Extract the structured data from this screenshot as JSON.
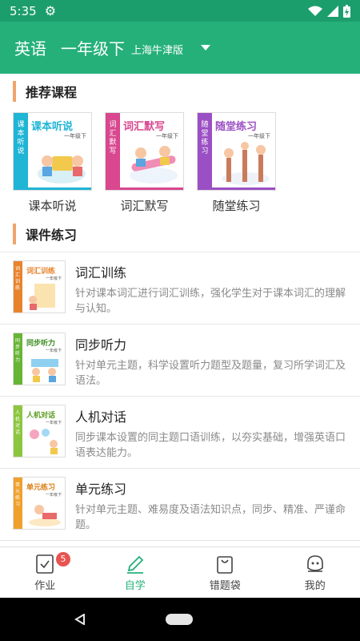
{
  "status": {
    "time": "5:35"
  },
  "header": {
    "subject": "英语",
    "grade": "一年级下",
    "edition": "上海牛津版"
  },
  "recommended": {
    "title": "推荐课程",
    "cards": [
      {
        "label": "课本听说",
        "cover_title": "课本听说",
        "spine": "课本听说",
        "grade": "一年级下",
        "color": "#1fb5d4"
      },
      {
        "label": "词汇默写",
        "cover_title": "词汇默写",
        "spine": "词汇默写",
        "grade": "一年级下",
        "color": "#d9478f"
      },
      {
        "label": "随堂练习",
        "cover_title": "随堂练习",
        "spine": "随堂练习",
        "grade": "一年级下",
        "color": "#9b4fc4"
      }
    ]
  },
  "practice": {
    "title": "课件练习",
    "items": [
      {
        "name": "词汇训练",
        "desc": "针对课本词汇进行词汇训练，强化学生对于课本词汇的理解与认知。",
        "thumb_title": "词汇训练",
        "spine": "词汇训练",
        "grade": "一年级下",
        "color": "#e8832d"
      },
      {
        "name": "同步听力",
        "desc": "针对单元主题，科学设置听力题型及题量，复习所学词汇及语法。",
        "thumb_title": "同步听力",
        "spine": "同步听力",
        "grade": "一年级下",
        "color": "#66b534"
      },
      {
        "name": "人机对话",
        "desc": "同步课本设置的同主题口语训练，以夯实基础，增强英语口语表达能力。",
        "thumb_title": "人机对话",
        "spine": "人机对话",
        "grade": "一年级下",
        "color": "#8cc63e"
      },
      {
        "name": "单元练习",
        "desc": "针对单元主题、难易度及语法知识点，同步、精准、严谨命题。",
        "thumb_title": "单元练习",
        "spine": "单元练习",
        "grade": "一年级下",
        "color": "#f0a02c"
      }
    ]
  },
  "tabs": [
    {
      "label": "作业",
      "icon": "homework-icon",
      "badge": "5"
    },
    {
      "label": "自学",
      "icon": "pencil-icon",
      "active": true
    },
    {
      "label": "错题袋",
      "icon": "bag-icon"
    },
    {
      "label": "我的",
      "icon": "profile-icon"
    }
  ],
  "colors": {
    "primary": "#25b07a",
    "status_bar": "#1c9e6c",
    "accent_bar": "#f0a46b",
    "badge": "#e9534f"
  }
}
